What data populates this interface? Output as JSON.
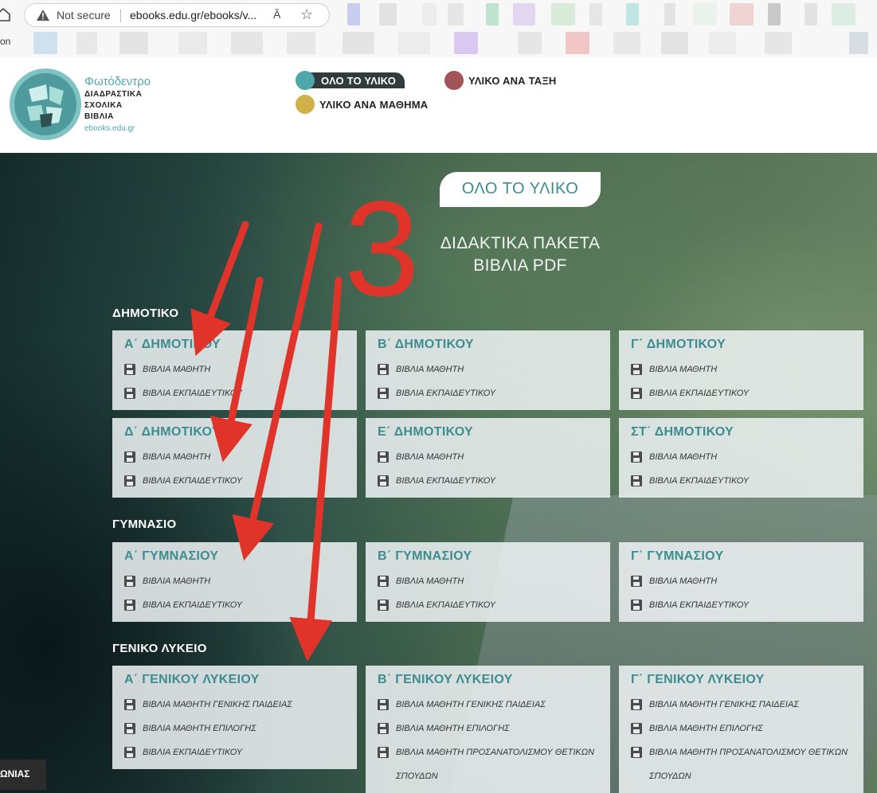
{
  "browser": {
    "not_secure": "Not secure",
    "url": "ebooks.edu.gr/ebooks/v...",
    "read_aloud": "Ă",
    "bookmark_left_fragment": "on"
  },
  "logo": {
    "title": "Φωτόδεντρο",
    "line1": "ΔΙΑΔΡΑΣΤΙΚΑ",
    "line2": "ΣΧΟΛΙΚΑ",
    "line3": "ΒΙΒΛΙΑ",
    "url": "ebooks.edu.gr"
  },
  "nav": {
    "all": "ΟΛΟ ΤΟ ΥΛΙΚΟ",
    "by_class": "ΥΛΙΚΟ ΑΝΑ ΤΑΞΗ",
    "by_subject": "ΥΛΙΚΟ ΑΝΑ ΜΑΘΗΜΑ"
  },
  "colors": {
    "teal": "#4ea8ab",
    "maroon": "#a45357",
    "gold": "#cfb34a",
    "title_teal": "#3d8c8f",
    "annotation_red": "#e0332a"
  },
  "hero": {
    "tab": "ΟΛΟ ΤΟ ΥΛΙΚΟ",
    "annotation_number": "3",
    "sub1": "ΔΙΔΑΚΤΙΚΑ ΠΑΚΕΤΑ",
    "sub2": "ΒΙΒΛΙΑ PDF"
  },
  "levels": {
    "dimotiko": "ΔΗΜΟΤΙΚΟ",
    "gymnasio": "ΓΥΜΝΑΣΙΟ",
    "lykeio": "ΓΕΝΙΚΟ ΛΥΚΕΙΟ"
  },
  "cards": {
    "a_dim": {
      "title": "Α΄ ΔΗΜΟΤΙΚΟΥ",
      "links": [
        "ΒΙΒΛΙΑ ΜΑΘΗΤΗ",
        "ΒΙΒΛΙΑ ΕΚΠΑΙΔΕΥΤΙΚΟΥ"
      ]
    },
    "b_dim": {
      "title": "Β΄ ΔΗΜΟΤΙΚΟΥ",
      "links": [
        "ΒΙΒΛΙΑ ΜΑΘΗΤΗ",
        "ΒΙΒΛΙΑ ΕΚΠΑΙΔΕΥΤΙΚΟΥ"
      ]
    },
    "g_dim": {
      "title": "Γ΄ ΔΗΜΟΤΙΚΟΥ",
      "links": [
        "ΒΙΒΛΙΑ ΜΑΘΗΤΗ",
        "ΒΙΒΛΙΑ ΕΚΠΑΙΔΕΥΤΙΚΟΥ"
      ]
    },
    "d_dim": {
      "title": "Δ΄ ΔΗΜΟΤΙΚΟΥ",
      "links": [
        "ΒΙΒΛΙΑ ΜΑΘΗΤΗ",
        "ΒΙΒΛΙΑ ΕΚΠΑΙΔΕΥΤΙΚΟΥ"
      ]
    },
    "e_dim": {
      "title": "Ε΄ ΔΗΜΟΤΙΚΟΥ",
      "links": [
        "ΒΙΒΛΙΑ ΜΑΘΗΤΗ",
        "ΒΙΒΛΙΑ ΕΚΠΑΙΔΕΥΤΙΚΟΥ"
      ]
    },
    "st_dim": {
      "title": "ΣΤ΄ ΔΗΜΟΤΙΚΟΥ",
      "links": [
        "ΒΙΒΛΙΑ ΜΑΘΗΤΗ",
        "ΒΙΒΛΙΑ ΕΚΠΑΙΔΕΥΤΙΚΟΥ"
      ]
    },
    "a_gym": {
      "title": "Α΄ ΓΥΜΝΑΣΙΟΥ",
      "links": [
        "ΒΙΒΛΙΑ ΜΑΘΗΤΗ",
        "ΒΙΒΛΙΑ ΕΚΠΑΙΔΕΥΤΙΚΟΥ"
      ]
    },
    "b_gym": {
      "title": "Β΄ ΓΥΜΝΑΣΙΟΥ",
      "links": [
        "ΒΙΒΛΙΑ ΜΑΘΗΤΗ",
        "ΒΙΒΛΙΑ ΕΚΠΑΙΔΕΥΤΙΚΟΥ"
      ]
    },
    "g_gym": {
      "title": "Γ΄ ΓΥΜΝΑΣΙΟΥ",
      "links": [
        "ΒΙΒΛΙΑ ΜΑΘΗΤΗ",
        "ΒΙΒΛΙΑ ΕΚΠΑΙΔΕΥΤΙΚΟΥ"
      ]
    },
    "a_lyk": {
      "title": "Α΄ ΓΕΝΙΚΟΥ ΛΥΚΕΙΟΥ",
      "links": [
        "ΒΙΒΛΙΑ ΜΑΘΗΤΗ ΓΕΝΙΚΗΣ ΠΑΙΔΕΙΑΣ",
        "ΒΙΒΛΙΑ ΜΑΘΗΤΗ ΕΠΙΛΟΓΗΣ",
        "ΒΙΒΛΙΑ ΕΚΠΑΙΔΕΥΤΙΚΟΥ"
      ]
    },
    "b_lyk": {
      "title": "Β΄ ΓΕΝΙΚΟΥ ΛΥΚΕΙΟΥ",
      "links": [
        "ΒΙΒΛΙΑ ΜΑΘΗΤΗ ΓΕΝΙΚΗΣ ΠΑΙΔΕΙΑΣ",
        "ΒΙΒΛΙΑ ΜΑΘΗΤΗ ΕΠΙΛΟΓΗΣ",
        "ΒΙΒΛΙΑ ΜΑΘΗΤΗ ΠΡΟΣΑΝΑΤΟΛΙΣΜΟΥ ΘΕΤΙΚΩΝ ΣΠΟΥΔΩΝ"
      ]
    },
    "g_lyk": {
      "title": "Γ΄ ΓΕΝΙΚΟΥ ΛΥΚΕΙΟΥ",
      "links": [
        "ΒΙΒΛΙΑ ΜΑΘΗΤΗ ΓΕΝΙΚΗΣ ΠΑΙΔΕΙΑΣ",
        "ΒΙΒΛΙΑ ΜΑΘΗΤΗ ΕΠΙΛΟΓΗΣ",
        "ΒΙΒΛΙΑ ΜΑΘΗΤΗ ΠΡΟΣΑΝΑΤΟΛΙΣΜΟΥ ΘΕΤΙΚΩΝ ΣΠΟΥΔΩΝ"
      ]
    }
  },
  "footer": {
    "corner_button": "ΩΝΙΑΣ"
  }
}
